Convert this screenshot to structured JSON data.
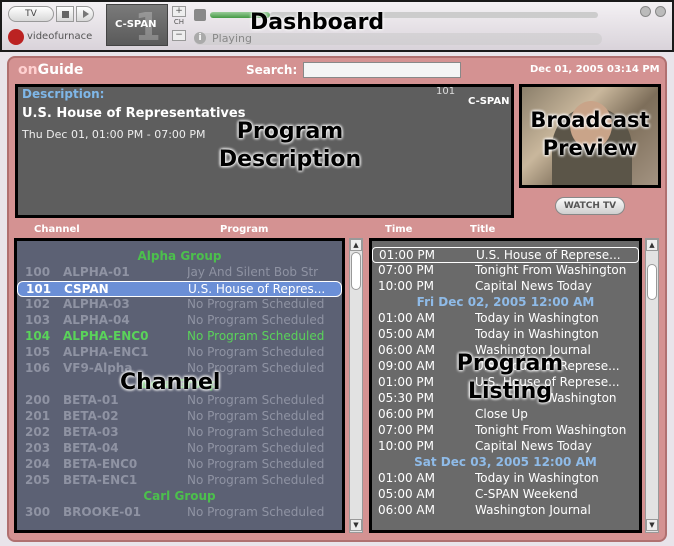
{
  "dashboard": {
    "title": "Dashboard",
    "tv_label": "TV",
    "brand": "videofurnace",
    "channel_logo": "C-SPAN",
    "channel_logo_number": "1",
    "ch_up": "+",
    "ch_label": "CH",
    "ch_down": "−",
    "status_icon": "i",
    "status": "Playing"
  },
  "main": {
    "brand_on": "on",
    "brand_guide": "Guide",
    "search_label": "Search:",
    "search_value": "",
    "datetime": "Dec 01, 2005 03:14 PM"
  },
  "description": {
    "label": "Description:",
    "channel_number": "101",
    "logo": "C-SPAN",
    "title": "U.S. House of Representatives",
    "time": "Thu Dec 01, 01:00 PM - 07:00 PM",
    "overlay": "Program Description"
  },
  "preview": {
    "overlay": "Broadcast Preview",
    "watch_button": "WATCH TV"
  },
  "columns": {
    "channel": "Channel",
    "program": "Program",
    "time": "Time",
    "title": "Title"
  },
  "channels": {
    "overlay": "Channel",
    "groups": [
      "Alpha Group",
      "Beta Group",
      "Carl Group"
    ],
    "rows": [
      {
        "num": "100",
        "name": "ALPHA-01",
        "program": "Jay And Silent Bob Str"
      },
      {
        "num": "101",
        "name": "CSPAN",
        "program": "U.S. House of Repres..."
      },
      {
        "num": "102",
        "name": "ALPHA-03",
        "program": "No Program Scheduled"
      },
      {
        "num": "103",
        "name": "ALPHA-04",
        "program": "No Program Scheduled"
      },
      {
        "num": "104",
        "name": "ALPHA-ENC0",
        "program": "No Program Scheduled"
      },
      {
        "num": "105",
        "name": "ALPHA-ENC1",
        "program": "No Program Scheduled"
      },
      {
        "num": "106",
        "name": "VF9-Alpha",
        "program": "No Program Scheduled"
      },
      {
        "num": "200",
        "name": "BETA-01",
        "program": "No Program Scheduled"
      },
      {
        "num": "201",
        "name": "BETA-02",
        "program": "No Program Scheduled"
      },
      {
        "num": "202",
        "name": "BETA-03",
        "program": "No Program Scheduled"
      },
      {
        "num": "203",
        "name": "BETA-04",
        "program": "No Program Scheduled"
      },
      {
        "num": "204",
        "name": "BETA-ENC0",
        "program": "No Program Scheduled"
      },
      {
        "num": "205",
        "name": "BETA-ENC1",
        "program": "No Program Scheduled"
      },
      {
        "num": "300",
        "name": "BROOKE-01",
        "program": "No Program Scheduled"
      }
    ]
  },
  "programs": {
    "overlay": "Program Listing",
    "dates": [
      "Fri Dec 02, 2005 12:00 AM",
      "Sat Dec 03, 2005 12:00 AM"
    ],
    "rows": [
      {
        "time": "01:00 PM",
        "title": "U.S. House of Represe..."
      },
      {
        "time": "07:00 PM",
        "title": "Tonight From Washington"
      },
      {
        "time": "10:00 PM",
        "title": "Capital News Today"
      },
      {
        "time": "01:00 AM",
        "title": "Today in Washington"
      },
      {
        "time": "05:00 AM",
        "title": "Today in Washington"
      },
      {
        "time": "06:00 AM",
        "title": "Washington Journal"
      },
      {
        "time": "09:00 AM",
        "title": "U.S. House of Represe..."
      },
      {
        "time": "01:00 PM",
        "title": "U.S. House of Represe..."
      },
      {
        "time": "05:30 PM",
        "title": "Washington"
      },
      {
        "time": "06:00 PM",
        "title": "Close Up"
      },
      {
        "time": "07:00 PM",
        "title": "Tonight From Washington"
      },
      {
        "time": "10:00 PM",
        "title": "Capital News Today"
      },
      {
        "time": "01:00 AM",
        "title": "Today in Washington"
      },
      {
        "time": "05:00 AM",
        "title": "C-SPAN Weekend"
      },
      {
        "time": "06:00 AM",
        "title": "Washington Journal"
      }
    ]
  },
  "scroll": {
    "up": "▲",
    "down": "▼"
  }
}
